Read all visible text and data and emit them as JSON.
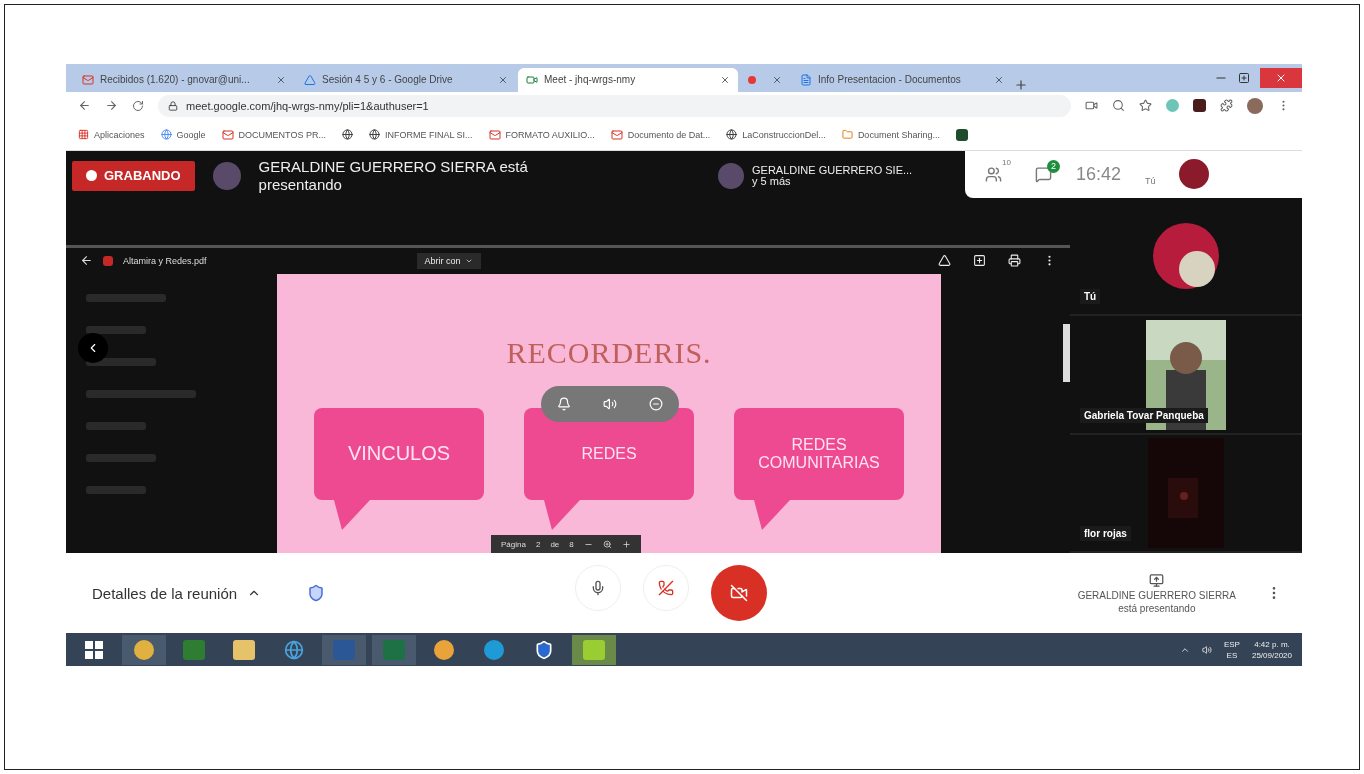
{
  "browser": {
    "tabs": [
      {
        "label": "Recibidos (1.620) - gnovar@uni...",
        "selected": false
      },
      {
        "label": "Sesión 4 5 y 6 - Google Drive",
        "selected": false
      },
      {
        "label": "Meet - jhq-wrgs-nmy",
        "selected": true
      },
      {
        "selected": false
      },
      {
        "label": "Info Presentacion - Documentos",
        "selected": false
      }
    ],
    "address": "meet.google.com/jhq-wrgs-nmy/pli=1&authuser=1",
    "bookmarks": [
      "Aplicaciones",
      "Google",
      "DOCUMENTOS PR...",
      "INFORME FINAL SI...",
      "FORMATO AUXILIO...",
      "Documento de Dat...",
      "LaConstruccionDel...",
      "Document Sharing..."
    ]
  },
  "meet": {
    "recording": "GRABANDO",
    "presenter_line": "GERALDINE GUERRERO SIERRA está presentando",
    "presenters": {
      "name": "GERALDINE GUERRERO SIE...",
      "more": "y 5 más"
    },
    "people_count": "10",
    "chat_badge": "2",
    "time": "16:42",
    "self_label": "Tú",
    "viewer": {
      "file": "Altamira y Redes.pdf",
      "open_with": "Abrir con",
      "page_label": "Página",
      "page": "2",
      "of": "de",
      "pages": "8"
    },
    "slide": {
      "title": "RECORDERIS.",
      "cards": [
        {
          "label": "VINCULOS"
        },
        {
          "label": "REDES"
        },
        {
          "label": "REDES COMUNITARIAS"
        }
      ]
    },
    "participants": [
      {
        "name": "Tú",
        "kind": "avatar"
      },
      {
        "name": "Gabriela Tovar Panqueba",
        "kind": "video"
      },
      {
        "name": "flor rojas",
        "kind": "dark"
      }
    ],
    "details": "Detalles de la reunión",
    "presenting": {
      "name": "GERALDINE GUERRERO SIERRA",
      "status": "está presentando"
    }
  },
  "taskbar": {
    "lang": "ESP",
    "lang_sub": "ES",
    "time": "4:42 p. m.",
    "date": "25/09/2020"
  }
}
